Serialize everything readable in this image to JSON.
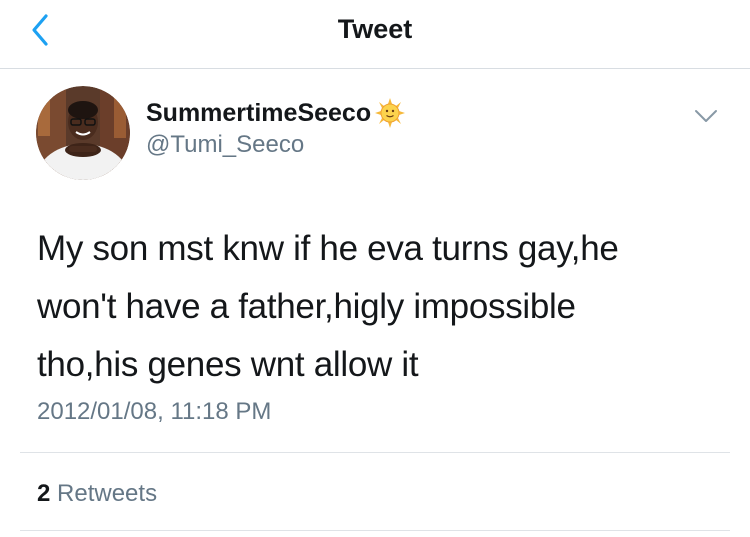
{
  "nav": {
    "title": "Tweet",
    "back_icon": "chevron-left-icon",
    "accent_color": "#1da1f2"
  },
  "author": {
    "display_name": "SummertimeSeeco",
    "handle": "@Tumi_Seeco",
    "badge_icon": "sun-with-face-emoji"
  },
  "tweet": {
    "lines": [
      "My son mst knw if he eva turns gay,he",
      "won't have a father,higly impossible",
      "tho,his genes wnt allow it"
    ],
    "timestamp": "2012/01/08, 11:18 PM"
  },
  "stats": {
    "retweets_count": "2",
    "retweets_label": "Retweets"
  },
  "menu_icon": "chevron-down-icon"
}
